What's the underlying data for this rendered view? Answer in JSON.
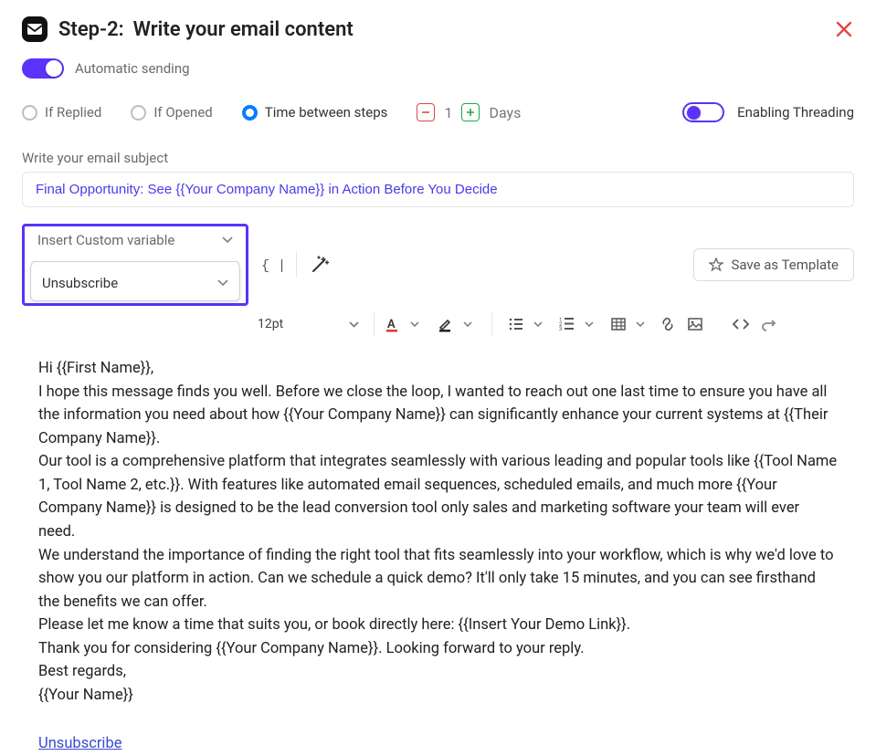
{
  "header": {
    "step_prefix": "Step-2:",
    "title": "Write your email content"
  },
  "auto_sending_label": "Automatic sending",
  "conditions": {
    "if_replied": "If Replied",
    "if_opened": "If Opened",
    "time_between": "Time between steps",
    "step_value": "1",
    "unit": "Days",
    "enable_threading": "Enabling Threading"
  },
  "subject": {
    "label": "Write your email subject",
    "value": "Final Opportunity: See {{Your Company Name}} in Action Before You Decide"
  },
  "custom_variable": {
    "placeholder": "Insert Custom variable",
    "selected": "Unsubscribe"
  },
  "save_template_label": "Save as Template",
  "font_size": "12pt",
  "email_body": {
    "l1": "Hi {{First Name}},",
    "l2": "I hope this message finds you well. Before we close the loop, I wanted to reach out one last time to ensure you have all the information you need about how {{Your Company Name}} can significantly enhance your current systems at {{Their Company Name}}.",
    "l3": "Our tool is a comprehensive platform that integrates seamlessly with various leading and popular tools like {{Tool Name 1, Tool Name 2, etc.}}. With features like automated email sequences, scheduled emails, and much more {{Your Company Name}} is designed to be the lead conversion tool only sales and marketing software your team will ever need.",
    "l4": "We understand the importance of finding the right tool that fits seamlessly into your workflow, which is why we'd love to show you our platform in action. Can we schedule a quick demo? It'll only take 15 minutes, and you can see firsthand the benefits we can offer.",
    "l5": "Please let me know a time that suits you, or book directly here: {{Insert Your Demo Link}}.",
    "l6": "Thank you for considering {{Your Company Name}}. Looking forward to your reply.",
    "l7": "Best regards,",
    "l8": "{{Your Name}}"
  },
  "unsubscribe_text": "Unsubscribe"
}
